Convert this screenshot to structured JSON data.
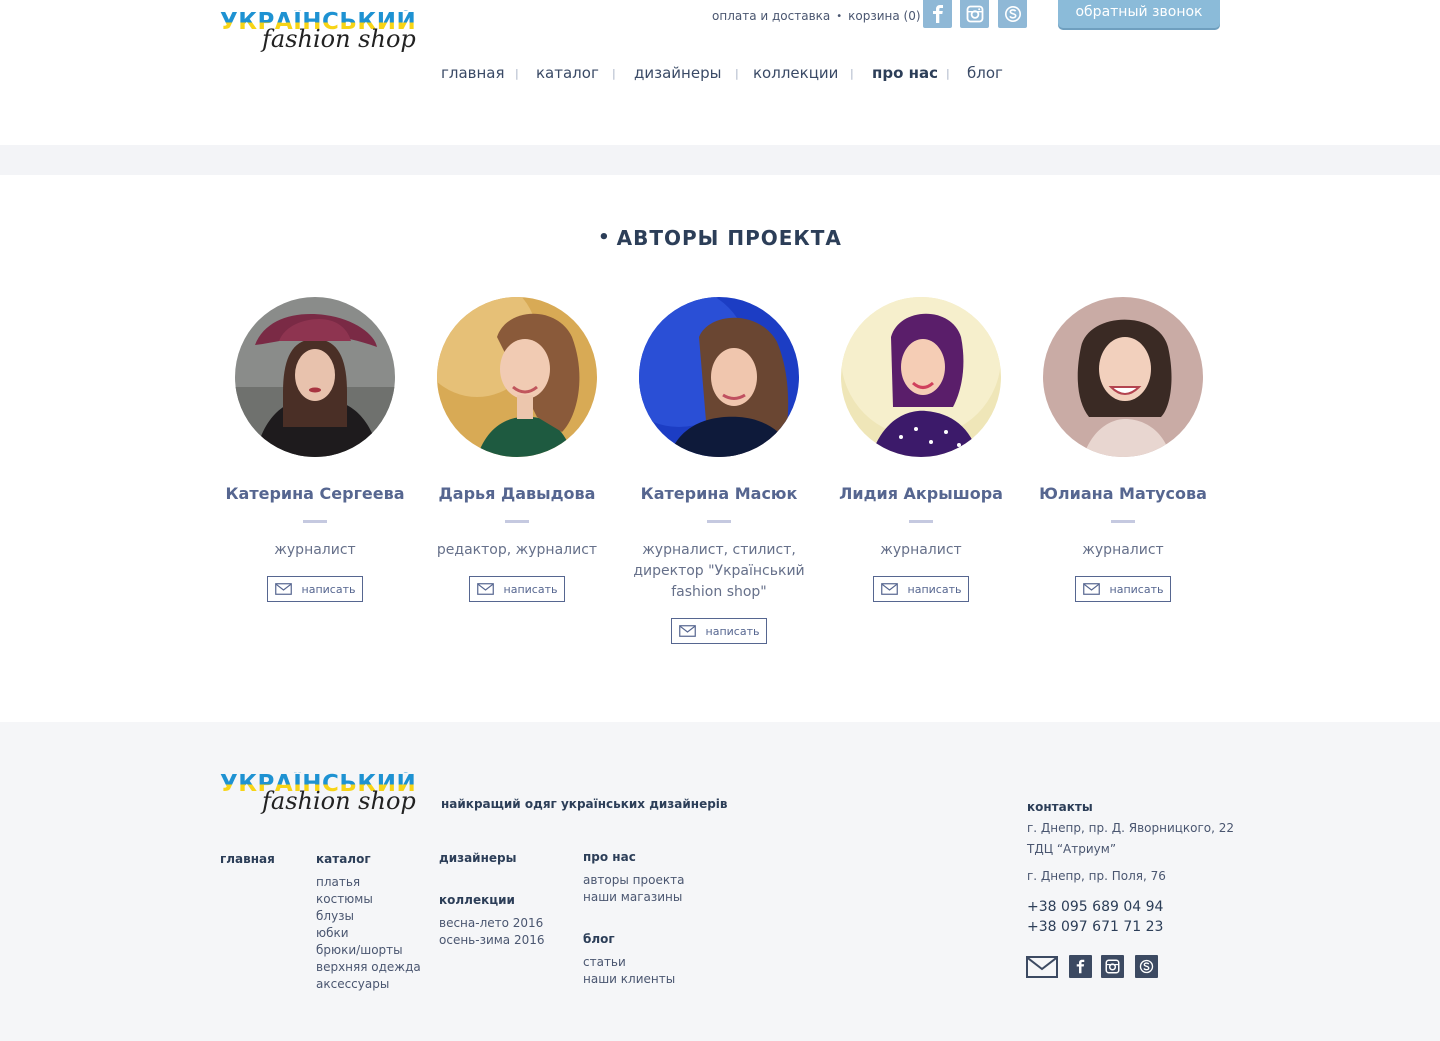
{
  "logo": {
    "line1": "УКРАЇНСЬКИЙ",
    "line2": "fashion shop"
  },
  "top_links": {
    "delivery": "оплата и доставка",
    "separator": "•",
    "cart": "корзина (0)"
  },
  "social": [
    "facebook-icon",
    "instagram-icon",
    "skype-icon"
  ],
  "callback_label": "обратный звонок",
  "nav": {
    "items": [
      "главная",
      "каталог",
      "дизайнеры",
      "коллекции",
      "про нас",
      "блог"
    ],
    "active": "про нас",
    "separator": "|"
  },
  "authors_section": {
    "bullet": "•",
    "title": "АВТОРЫ ПРОЕКТА",
    "write_label": "написать",
    "authors": [
      {
        "name": "Катерина Сергеева",
        "role": "журналист"
      },
      {
        "name": "Дарья Давыдова",
        "role": "редактор, журналист"
      },
      {
        "name": "Катерина Масюк",
        "role": "журналист, стилист, директор \"Український fashion shop\""
      },
      {
        "name": "Лидия Акрышора",
        "role": "журналист"
      },
      {
        "name": "Юлиана Матусова",
        "role": "журналист"
      }
    ]
  },
  "footer": {
    "tagline": "найкращий одяг українських дизайнерів",
    "main": "главная",
    "catalog": {
      "title": "каталог",
      "items": [
        "платья",
        "костюмы",
        "блузы",
        "юбки",
        "брюки/шорты",
        "верхняя одежда",
        "аксессуары"
      ]
    },
    "designers": "дизайнеры",
    "collections": {
      "title": "коллекции",
      "items": [
        "весна-лето 2016",
        "осень-зима 2016"
      ]
    },
    "about": {
      "title": "про нас",
      "items": [
        "авторы проекта",
        "наши магазины"
      ]
    },
    "blog": {
      "title": "блог",
      "items": [
        "статьи",
        "наши клиенты"
      ]
    },
    "contacts": {
      "title": "контакты",
      "address1": "г. Днепр, пр. Д. Яворницкого, 22",
      "address1b": "ТДЦ “Атриум”",
      "address2": "г. Днепр, пр. Поля, 76",
      "phone1": "+38 095 689 04 94",
      "phone2": "+38 097 671 71 23"
    },
    "social": [
      "mail-icon",
      "facebook-icon",
      "instagram-icon",
      "skype-icon"
    ]
  },
  "colors": {
    "accent": "#8bbbd9",
    "heading": "#2c3e58",
    "name": "#566690",
    "footer_bg": "#f5f6f8",
    "logo_blue": "#1e92d2",
    "logo_yellow": "#f7d416"
  }
}
